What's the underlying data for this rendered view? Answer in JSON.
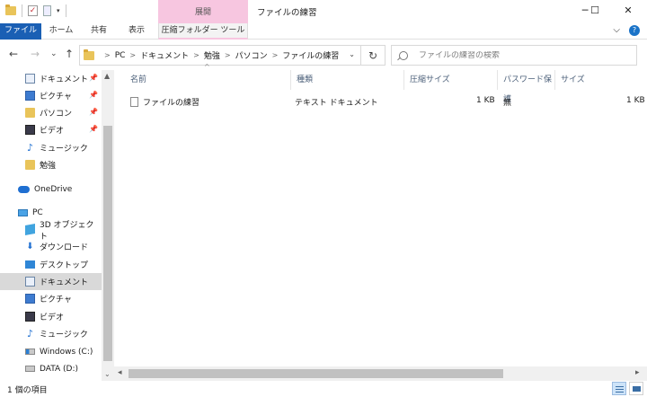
{
  "window": {
    "title": "ファイルの練習",
    "tool_tab_header": "展開",
    "controls": {
      "minimize": "─",
      "maximize": "☐",
      "close": "✕"
    }
  },
  "quick_access_toolbar": {
    "dropdown": "▾"
  },
  "ribbon": {
    "tabs": [
      "ファイル",
      "ホーム",
      "共有",
      "表示"
    ],
    "tool_tab": "圧縮フォルダー ツール",
    "collapse": "⌵",
    "help": "?"
  },
  "navigation": {
    "back": "←",
    "forward": "→",
    "recent": "⌄",
    "up": "↑"
  },
  "address_bar": {
    "crumbs": [
      "PC",
      "ドキュメント",
      "勉強",
      "パソコン",
      "ファイルの練習"
    ],
    "separator": ">",
    "dropdown": "⌄",
    "refresh": "↻"
  },
  "search": {
    "placeholder": "ファイルの練習の検索"
  },
  "nav_pane": {
    "quick_access": [
      {
        "label": "ドキュメント",
        "icon": "documents-icon",
        "pinned": true
      },
      {
        "label": "ピクチャ",
        "icon": "pictures-icon",
        "pinned": true
      },
      {
        "label": "パソコン",
        "icon": "folder-icon",
        "pinned": true
      },
      {
        "label": "ビデオ",
        "icon": "videos-icon",
        "pinned": true
      },
      {
        "label": "ミュージック",
        "icon": "music-icon",
        "pinned": false
      },
      {
        "label": "勉強",
        "icon": "folder-icon",
        "pinned": false
      }
    ],
    "onedrive": "OneDrive",
    "pc": "PC",
    "pc_items": [
      {
        "label": "3D オブジェクト",
        "icon": "3d-objects-icon"
      },
      {
        "label": "ダウンロード",
        "icon": "downloads-icon"
      },
      {
        "label": "デスクトップ",
        "icon": "desktop-icon"
      },
      {
        "label": "ドキュメント",
        "icon": "documents-icon",
        "selected": true
      },
      {
        "label": "ピクチャ",
        "icon": "pictures-icon"
      },
      {
        "label": "ビデオ",
        "icon": "videos-icon"
      },
      {
        "label": "ミュージック",
        "icon": "music-icon"
      },
      {
        "label": "Windows (C:)",
        "icon": "windows-drive-icon"
      },
      {
        "label": "DATA (D:)",
        "icon": "drive-icon"
      }
    ],
    "pin_glyph": "📌"
  },
  "file_list": {
    "columns": [
      "名前",
      "種類",
      "圧縮サイズ",
      "パスワード保護",
      "サイズ"
    ],
    "sort_glyph": "^",
    "rows": [
      {
        "name": "ファイルの練習",
        "type": "テキスト ドキュメント",
        "compressed_size": "1 KB",
        "password": "無",
        "size": "1 KB"
      }
    ]
  },
  "status": {
    "item_count": "1 個の項目"
  },
  "colors": {
    "file_tab": "#1a5fb4",
    "tool_tab": "#f7c6e0",
    "selected": "#d9d9d9"
  }
}
